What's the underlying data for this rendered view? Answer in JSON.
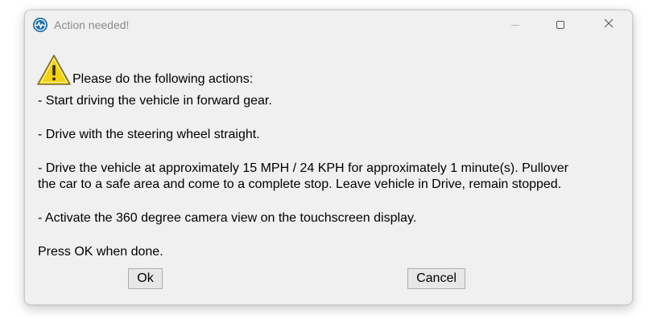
{
  "window": {
    "title": "Action needed!"
  },
  "icons": {
    "app": "app-pulse-icon",
    "warning": "warning-icon",
    "minimize": "minimize-icon",
    "maximize": "maximize-icon",
    "close": "close-icon"
  },
  "message": {
    "header": "Please do the following actions:",
    "step1": "- Start driving the vehicle in forward gear.",
    "step2": "- Drive with the steering wheel straight.",
    "step3_line1": "- Drive the vehicle at approximately 15 MPH / 24 KPH for approximately 1 minute(s). Pullover",
    "step3_line2": "the car to a safe area and come to a complete stop. Leave vehicle in Drive, remain stopped.",
    "step4": "- Activate the 360 degree camera view on the touchscreen display.",
    "footer": "Press OK when done."
  },
  "buttons": {
    "ok": "Ok",
    "cancel": "Cancel"
  },
  "colors": {
    "window_bg": "#f0f0f0",
    "title_text": "#8c8c8c",
    "app_icon": "#1f6fa8",
    "warning_fill": "#f2d21a"
  }
}
